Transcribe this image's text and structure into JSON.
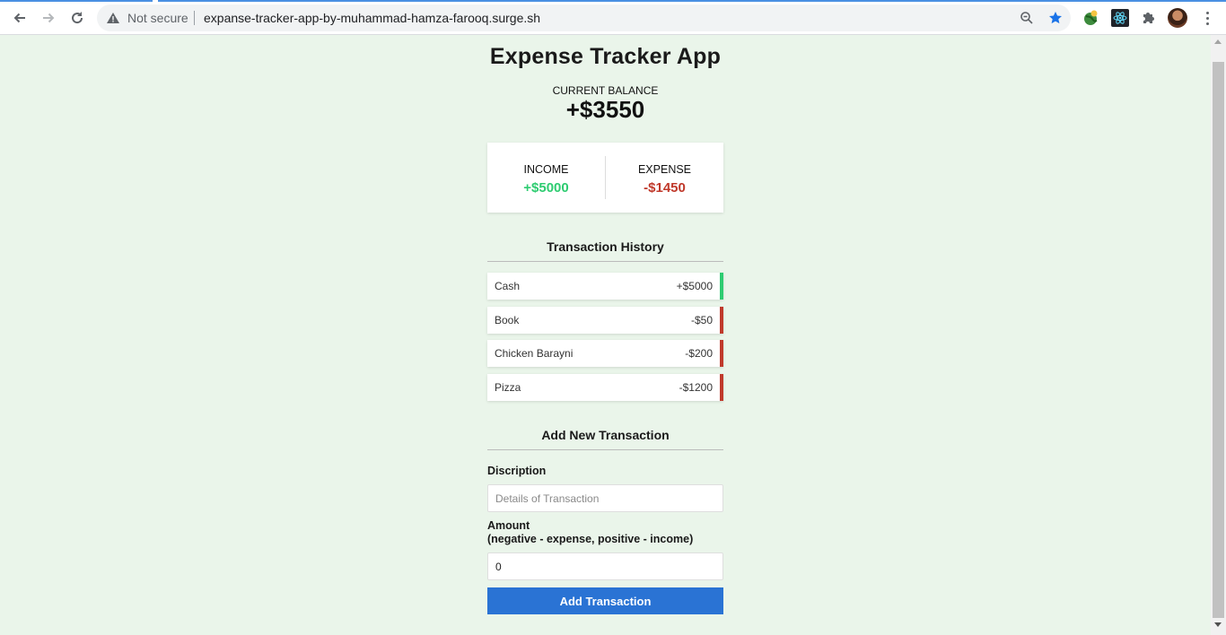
{
  "browser": {
    "security_text": "Not secure",
    "url": "expanse-tracker-app-by-muhammad-hamza-farooq.surge.sh"
  },
  "app": {
    "title": "Expense Tracker App",
    "balance_label": "CURRENT BALANCE",
    "balance_amount": "+$3550",
    "income_label": "INCOME",
    "income_amount": "+$5000",
    "expense_label": "EXPENSE",
    "expense_amount": "-$1450",
    "history_title": "Transaction History",
    "transactions": [
      {
        "name": "Cash",
        "amount": "+$5000",
        "type": "income"
      },
      {
        "name": "Book",
        "amount": "-$50",
        "type": "expense"
      },
      {
        "name": "Chicken Barayni",
        "amount": "-$200",
        "type": "expense"
      },
      {
        "name": "Pizza",
        "amount": "-$1200",
        "type": "expense"
      }
    ],
    "add_title": "Add New Transaction",
    "description_label": "Discription",
    "description_placeholder": "Details of Transaction",
    "amount_label": "Amount",
    "amount_hint": "(negative - expense, positive - income)",
    "amount_value": "0",
    "submit_label": "Add Transaction"
  },
  "colors": {
    "background": "#eaf5ea",
    "income": "#2ecc71",
    "expense": "#c0392b",
    "button": "#2a73d4"
  }
}
